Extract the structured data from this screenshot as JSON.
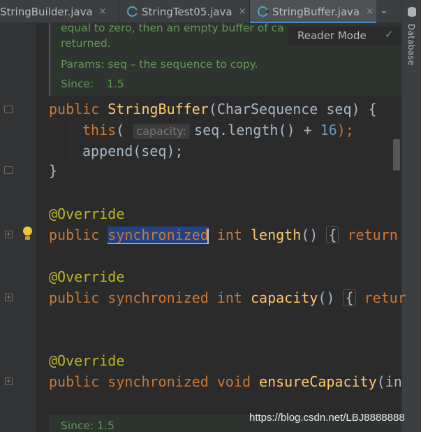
{
  "tabs": [
    {
      "label": "StringBuilder.java",
      "close": "×"
    },
    {
      "label": "StringTest05.java",
      "close": "×"
    },
    {
      "label": "StringBuffer.java",
      "close": "×",
      "active": true
    }
  ],
  "tab_overflow": "⌄",
  "sidebar": {
    "database_label": "Database"
  },
  "reader_mode": {
    "label": "Reader Mode",
    "check": "✓"
  },
  "doc": {
    "line1": "equal to zero, then an empty buffer of ca",
    "line2": "returned.",
    "params": "Params: seq – the sequence to copy.",
    "since_label": "Since:",
    "since_value": "1.5",
    "bottom_since": "Since: 1.5"
  },
  "code": {
    "l1": {
      "kw": "public ",
      "fn": "StringBuffer",
      "rest": "(CharSequence seq) {"
    },
    "l2": {
      "kw": "this",
      "open": "(",
      "hint": "capacity:",
      "body": "seq.length() + ",
      "num": "16",
      "close": ");"
    },
    "l3": {
      "text": "append(seq);"
    },
    "l4": {
      "text": "}"
    },
    "ann1": "@Override",
    "l5": {
      "kw1": "public ",
      "sel": "synchronized",
      "kw2": " int ",
      "fn": "length",
      "paren": "()",
      "brace": "{",
      "ret": " return"
    },
    "ann2": "@Override",
    "l6": {
      "kw": "public synchronized int ",
      "fn": "capacity",
      "paren": "()",
      "brace": "{",
      "ret": " retur"
    },
    "ann3": "@Override",
    "l7": {
      "kw": "public synchronized void ",
      "fn": "ensureCapacity",
      "paren": "(in"
    }
  },
  "watermark": "https://blog.csdn.net/LBJ8888888",
  "colors": {
    "keyword": "#cc7832",
    "function": "#ffc66d",
    "annotation": "#bbb529",
    "number": "#6897bb",
    "doc": "#629755",
    "selection": "#214283"
  }
}
